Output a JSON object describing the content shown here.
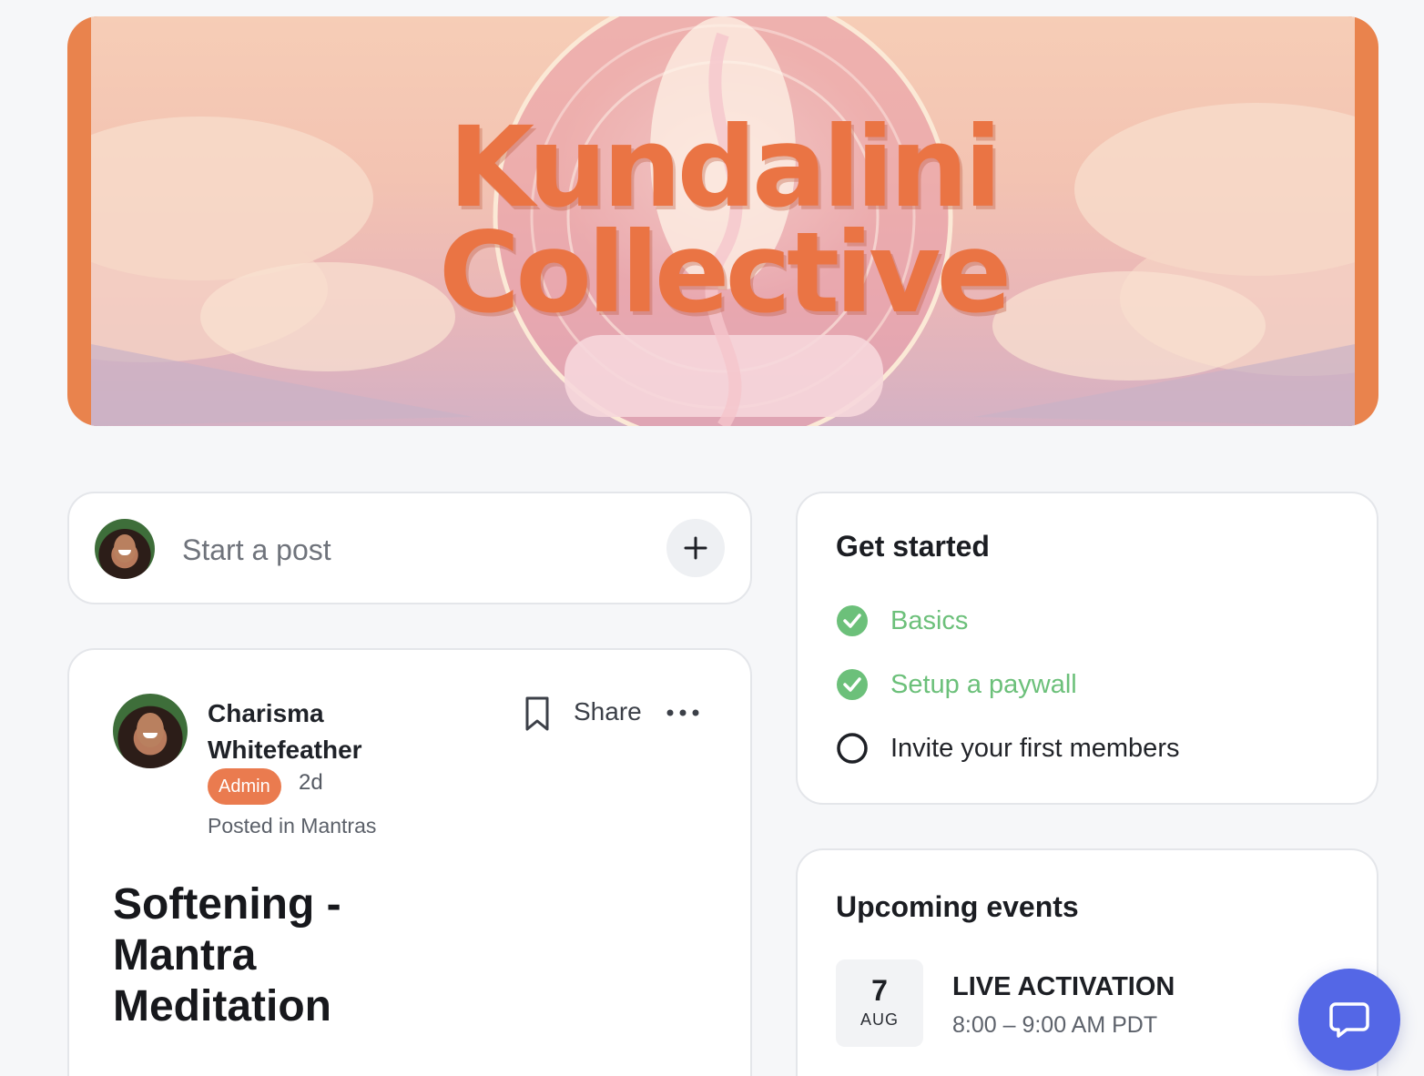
{
  "banner": {
    "title_line1": "Kundalini",
    "title_line2": "Collective"
  },
  "composer": {
    "placeholder": "Start a post",
    "add_icon": "plus-icon"
  },
  "post": {
    "author": "Charisma Whitefeather",
    "badge": "Admin",
    "time": "2d",
    "posted_in": "Posted in Mantras",
    "share_label": "Share",
    "title": "Softening - Mantra Meditation",
    "icons": [
      "bookmark-icon",
      "more-horizontal-icon"
    ]
  },
  "get_started": {
    "heading": "Get started",
    "items": [
      {
        "label": "Basics",
        "done": true
      },
      {
        "label": "Setup a paywall",
        "done": true
      },
      {
        "label": "Invite your first members",
        "done": false
      }
    ]
  },
  "events": {
    "heading": "Upcoming events",
    "items": [
      {
        "day": "7",
        "month": "AUG",
        "title": "LIVE ACTIVATION",
        "time": "8:00 – 9:00 AM PDT"
      }
    ]
  },
  "chat": {
    "icon": "chat-bubble-icon"
  },
  "colors": {
    "accent_orange": "#ea7b4f",
    "success_green": "#6cc07a",
    "chat_blue": "#5467e6"
  }
}
